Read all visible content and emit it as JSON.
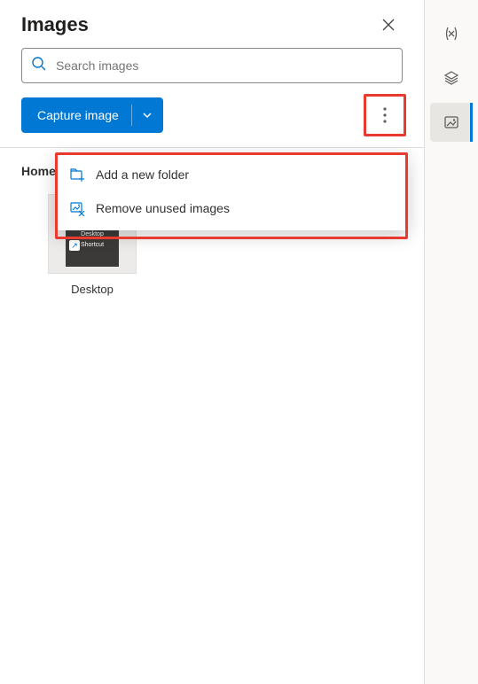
{
  "panel": {
    "title": "Images"
  },
  "search": {
    "placeholder": "Search images"
  },
  "actions": {
    "capture_label": "Capture image"
  },
  "more_menu": {
    "items": [
      {
        "label": "Add a new folder",
        "icon": "add-folder-icon"
      },
      {
        "label": "Remove unused images",
        "icon": "remove-images-icon"
      }
    ]
  },
  "breadcrumb": {
    "root": "Home"
  },
  "gallery": {
    "items": [
      {
        "caption": "Desktop",
        "thumb_text_line1": "Desktop",
        "thumb_text_line2": "Shortcut"
      }
    ]
  },
  "right_rail": {
    "items": [
      {
        "name": "variables-icon"
      },
      {
        "name": "layers-icon"
      },
      {
        "name": "images-icon",
        "active": true
      }
    ]
  },
  "colors": {
    "accent": "#0078d4",
    "highlight": "#e83a2f"
  }
}
